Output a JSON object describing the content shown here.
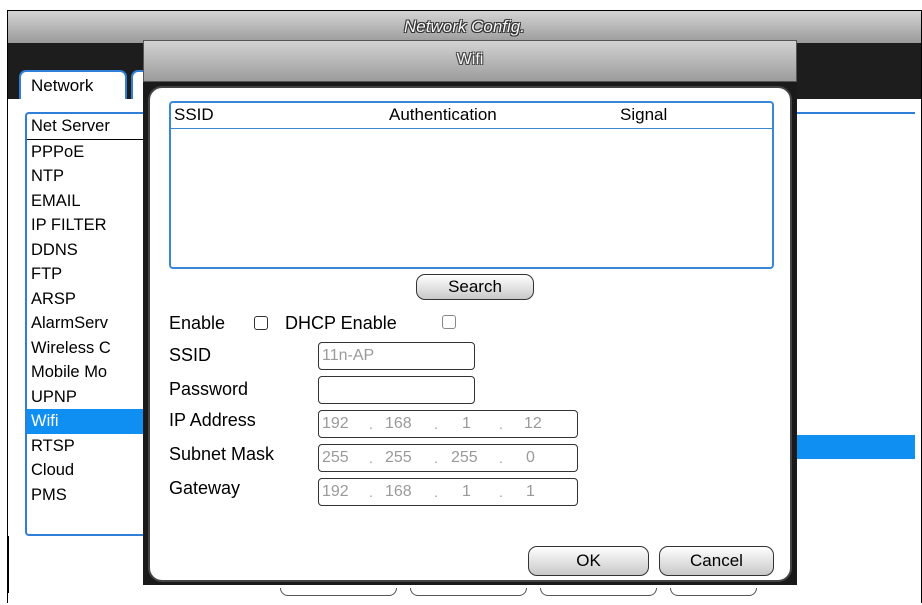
{
  "background_window": {
    "title": "Network Config.",
    "tabs": [
      {
        "label": "Network"
      }
    ],
    "services": [
      "Net Server",
      "PPPoE",
      "NTP",
      "EMAIL",
      "IP FILTER",
      "DDNS",
      "FTP",
      "ARSP",
      "AlarmServ",
      "Wireless C",
      "Mobile Mo",
      "UPNP",
      "Wifi",
      "RTSP",
      "Cloud",
      "PMS"
    ],
    "selected_service": "Wifi"
  },
  "dialog": {
    "title": "Wifi",
    "table": {
      "columns": [
        "SSID",
        "Authentication",
        "Signal"
      ],
      "rows": []
    },
    "search_label": "Search",
    "enable_label": "Enable",
    "enable_checked": false,
    "dhcp_label": "DHCP Enable",
    "dhcp_checked": false,
    "fields": {
      "ssid_label": "SSID",
      "ssid_value": "11n-AP",
      "password_label": "Password",
      "password_value": "",
      "ip_label": "IP Address",
      "ip_value": [
        "192",
        "168",
        "1",
        "12"
      ],
      "mask_label": "Subnet Mask",
      "mask_value": [
        "255",
        "255",
        "255",
        "0"
      ],
      "gateway_label": "Gateway",
      "gateway_value": [
        "192",
        "168",
        "1",
        "1"
      ]
    },
    "ok_label": "OK",
    "cancel_label": "Cancel"
  },
  "colors": {
    "selection": "#0f8ff2",
    "border_accent": "#2f7fd9",
    "dialog_frame": "#1a1a1a",
    "field_text": "#9a9a9a"
  }
}
